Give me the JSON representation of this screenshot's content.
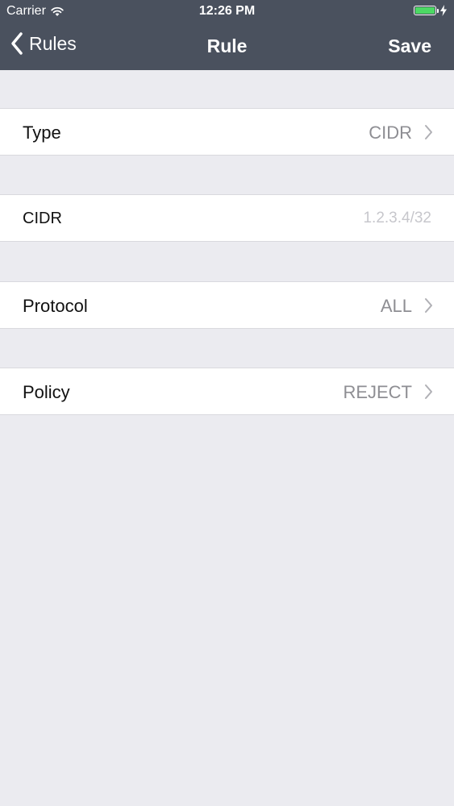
{
  "status_bar": {
    "carrier": "Carrier",
    "time": "12:26 PM",
    "battery_level": 1.0,
    "battery_color": "#4cd964"
  },
  "nav": {
    "back_label": "Rules",
    "title": "Rule",
    "save_label": "Save",
    "bar_color": "#4a515e"
  },
  "rows": [
    {
      "label": "Type",
      "value": "CIDR"
    },
    {
      "label": "CIDR",
      "input_value": "",
      "placeholder": "1.2.3.4/32"
    },
    {
      "label": "Protocol",
      "value": "ALL"
    },
    {
      "label": "Policy",
      "value": "REJECT"
    }
  ],
  "icons": {
    "wifi": "wifi-icon",
    "battery": "battery-icon",
    "charging": "charging-bolt-icon",
    "back": "chevron-left-icon",
    "disclosure": "chevron-right-icon"
  }
}
